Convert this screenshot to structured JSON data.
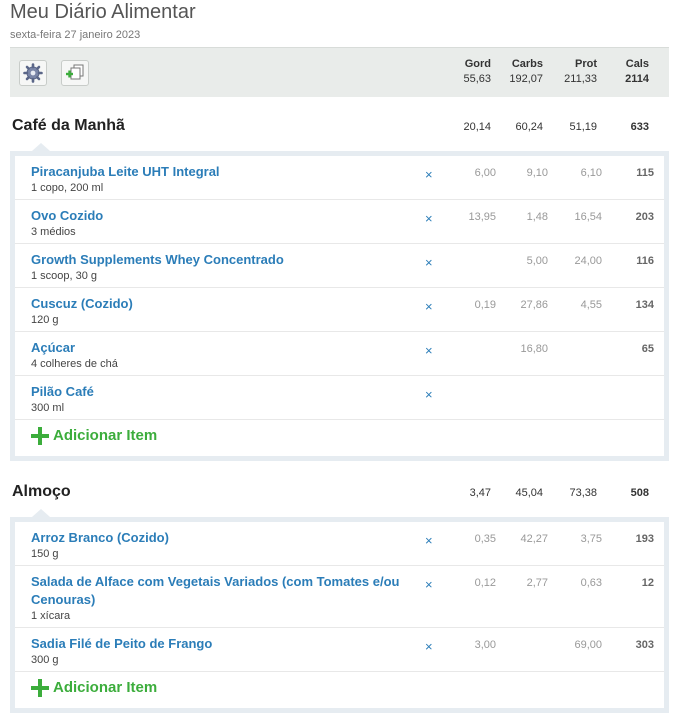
{
  "header": {
    "title": "Meu Diário Alimentar",
    "date": "sexta-feira 27 janeiro 2023"
  },
  "summary": {
    "columns": [
      {
        "label": "Gord",
        "value": "55,63"
      },
      {
        "label": "Carbs",
        "value": "192,07"
      },
      {
        "label": "Prot",
        "value": "211,33"
      },
      {
        "label": "Cals",
        "value": "2114"
      }
    ],
    "settings_icon": "gear-icon",
    "copy_icon": "copy-add-icon"
  },
  "meals": [
    {
      "name": "Café da Manhã",
      "totals": {
        "fat": "20,14",
        "carbs": "60,24",
        "prot": "51,19",
        "cals": "633"
      },
      "items": [
        {
          "name": "Piracanjuba Leite UHT Integral",
          "portion": "1 copo, 200 ml",
          "fat": "6,00",
          "carbs": "9,10",
          "prot": "6,10",
          "cals": "115"
        },
        {
          "name": "Ovo Cozido",
          "portion": "3 médios",
          "fat": "13,95",
          "carbs": "1,48",
          "prot": "16,54",
          "cals": "203"
        },
        {
          "name": "Growth Supplements Whey Concentrado",
          "portion": "1 scoop, 30 g",
          "fat": "",
          "carbs": "5,00",
          "prot": "24,00",
          "cals": "116"
        },
        {
          "name": "Cuscuz (Cozido)",
          "portion": "120 g",
          "fat": "0,19",
          "carbs": "27,86",
          "prot": "4,55",
          "cals": "134"
        },
        {
          "name": "Açúcar",
          "portion": "4 colheres de chá",
          "fat": "",
          "carbs": "16,80",
          "prot": "",
          "cals": "65"
        },
        {
          "name": "Pilão Café",
          "portion": "300 ml",
          "fat": "",
          "carbs": "",
          "prot": "",
          "cals": ""
        }
      ],
      "add_label": "Adicionar Item"
    },
    {
      "name": "Almoço",
      "totals": {
        "fat": "3,47",
        "carbs": "45,04",
        "prot": "73,38",
        "cals": "508"
      },
      "items": [
        {
          "name": "Arroz Branco (Cozido)",
          "portion": "150 g",
          "fat": "0,35",
          "carbs": "42,27",
          "prot": "3,75",
          "cals": "193"
        },
        {
          "name": "Salada de Alface com Vegetais Variados (com Tomates e/ou Cenouras)",
          "portion": "1 xícara",
          "fat": "0,12",
          "carbs": "2,77",
          "prot": "0,63",
          "cals": "12"
        },
        {
          "name": "Sadia Filé de Peito de Frango",
          "portion": "300 g",
          "fat": "3,00",
          "carbs": "",
          "prot": "69,00",
          "cals": "303"
        }
      ],
      "add_label": "Adicionar Item"
    }
  ],
  "remove_symbol": "×"
}
